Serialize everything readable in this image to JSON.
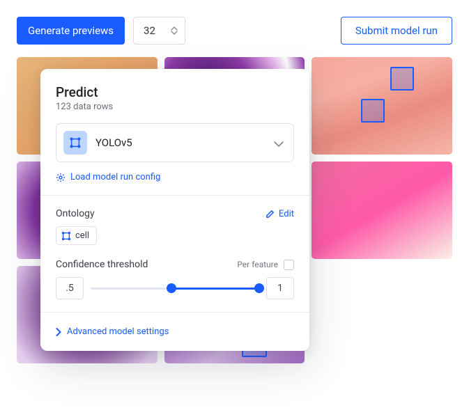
{
  "toolbar": {
    "generate_previews_label": "Generate previews",
    "batch_size": "32",
    "submit_label": "Submit model run"
  },
  "panel": {
    "title": "Predict",
    "subtitle": "123 data rows",
    "model_name": "YOLOv5",
    "model_icon": "bounding-box-icon",
    "load_config_label": "Load model run config",
    "ontology": {
      "heading": "Ontology",
      "edit_label": "Edit",
      "tags": [
        "cell"
      ]
    },
    "threshold": {
      "heading": "Confidence threshold",
      "per_feature_label": "Per feature",
      "per_feature_checked": false,
      "low": ".5",
      "high": "1"
    },
    "advanced_label": "Advanced model settings"
  },
  "colors": {
    "accent": "#1a5cff"
  }
}
